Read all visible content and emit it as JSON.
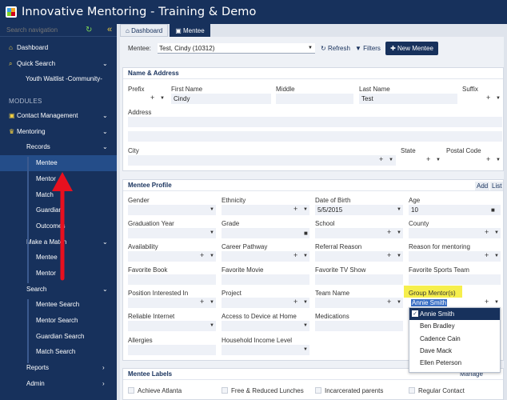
{
  "app": {
    "title": "Innovative Mentoring - Training & Demo"
  },
  "sidebar": {
    "search_placeholder": "Search navigation",
    "items": [
      {
        "label": "Dashboard"
      },
      {
        "label": "Quick Search"
      },
      {
        "label": "Youth Waitlist -Community-"
      },
      {
        "label": "MODULES"
      },
      {
        "label": "Contact Management"
      },
      {
        "label": "Mentoring"
      },
      {
        "label": "Records"
      },
      {
        "label": "Mentee"
      },
      {
        "label": "Mentor"
      },
      {
        "label": "Match"
      },
      {
        "label": "Guardian"
      },
      {
        "label": "Outcomes"
      },
      {
        "label": "Make a Match"
      },
      {
        "label": "Mentee"
      },
      {
        "label": "Mentor"
      },
      {
        "label": "Search"
      },
      {
        "label": "Mentee Search"
      },
      {
        "label": "Mentor Search"
      },
      {
        "label": "Guardian Search"
      },
      {
        "label": "Match Search"
      },
      {
        "label": "Reports"
      },
      {
        "label": "Admin"
      }
    ]
  },
  "tabs": [
    {
      "label": "Dashboard"
    },
    {
      "label": "Mentee"
    }
  ],
  "toolbar": {
    "mentee_label": "Mentee:",
    "mentee_value": "Test, Cindy (10312)",
    "refresh": "Refresh",
    "filters": "Filters",
    "new_mentee": "New Mentee"
  },
  "name_address": {
    "title": "Name & Address",
    "prefix_label": "Prefix",
    "first_label": "First Name",
    "first_value": "Cindy",
    "middle_label": "Middle",
    "last_label": "Last Name",
    "last_value": "Test",
    "suffix_label": "Suffix",
    "address_label": "Address",
    "city_label": "City",
    "state_label": "State",
    "postal_label": "Postal Code"
  },
  "profile": {
    "title": "Mentee Profile",
    "add": "Add",
    "list": "List",
    "gender": "Gender",
    "ethnicity": "Ethnicity",
    "dob": "Date of Birth",
    "dob_value": "5/5/2015",
    "age": "Age",
    "age_value": "10",
    "grad_year": "Graduation Year",
    "grade": "Grade",
    "school": "School",
    "county": "County",
    "availability": "Availability",
    "career": "Career Pathway",
    "referral": "Referral Reason",
    "reason": "Reason for mentoring",
    "book": "Favorite Book",
    "movie": "Favorite Movie",
    "tv": "Favorite TV Show",
    "sports": "Favorite Sports Team",
    "position": "Position Interested In",
    "project": "Project",
    "team": "Team Name",
    "group_mentor": "Group Mentor(s)",
    "group_mentor_value": "Annie Smith",
    "internet": "Reliable Internet",
    "device": "Access to Device at Home",
    "medications": "Medications",
    "allergies": "Allergies",
    "income": "Household Income Level"
  },
  "popup": {
    "options": [
      {
        "label": "Annie Smith",
        "checked": true
      },
      {
        "label": "Ben Bradley"
      },
      {
        "label": "Cadence Cain"
      },
      {
        "label": "Dave Mack"
      },
      {
        "label": "Ellen Peterson"
      }
    ]
  },
  "labels": {
    "title": "Mentee Labels",
    "manage": "Manage",
    "items": [
      {
        "label": "Achieve Atlanta"
      },
      {
        "label": "Free & Reduced Lunches"
      },
      {
        "label": "Incarcerated parents"
      },
      {
        "label": "Regular Contact"
      }
    ]
  }
}
